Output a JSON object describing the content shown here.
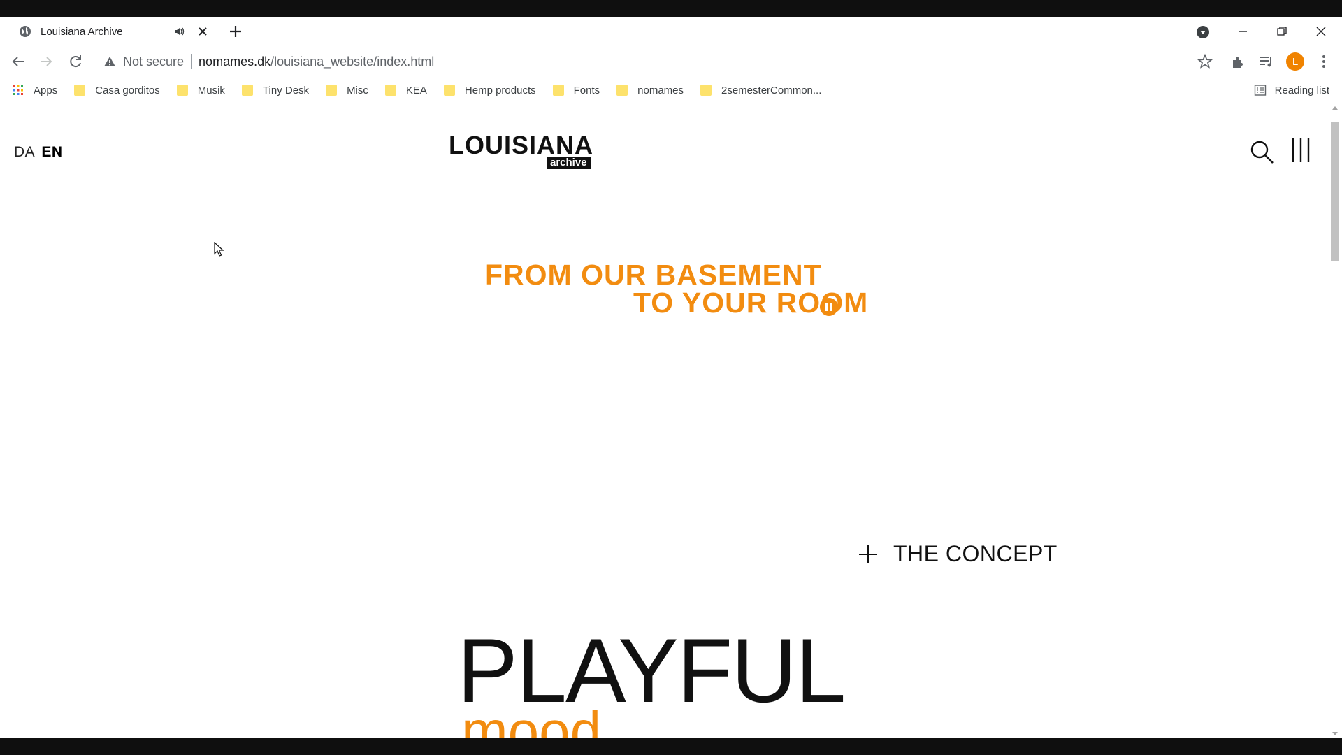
{
  "tab": {
    "title": "Louisiana Archive"
  },
  "omnibox": {
    "security": "Not secure",
    "host": "nomames.dk",
    "path": "/louisiana_website/index.html"
  },
  "profile": {
    "initial": "L"
  },
  "bookmarks": {
    "apps": "Apps",
    "items": [
      "Casa gorditos",
      "Musik",
      "Tiny Desk",
      "Misc",
      "KEA",
      "Hemp products",
      "Fonts",
      "nomames",
      "2semesterCommon..."
    ],
    "reading_list": "Reading list"
  },
  "site": {
    "lang_da": "DA",
    "lang_en": "EN",
    "logo_word": "LOUISIANA",
    "logo_sub": "archive",
    "hero_line1": "FROM OUR BASEMENT",
    "hero_line2": "TO YOUR ROOM",
    "concept_label": "THE CONCEPT",
    "headline": "PLAYFUL",
    "subheadline": "mood"
  },
  "colors": {
    "accent": "#f28c10",
    "text": "#111111"
  }
}
